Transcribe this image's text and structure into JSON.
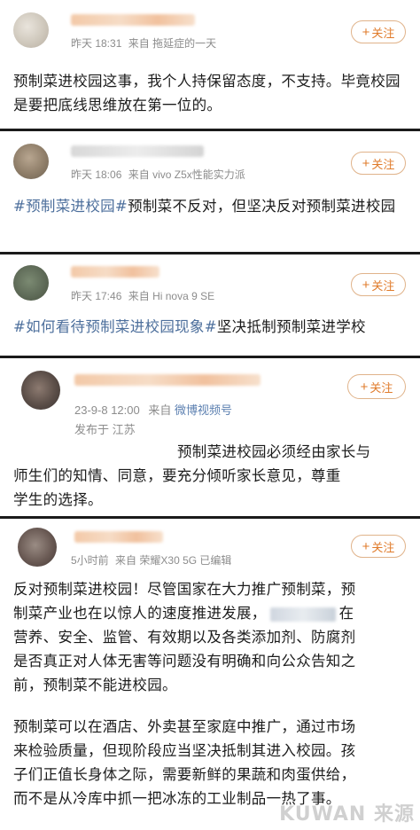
{
  "posts": [
    {
      "time": "昨天 18:31",
      "source_prefix": "来自",
      "source": "拖延症的一天",
      "follow_label": "关注",
      "text": "预制菜进校园这事，我个人持保留态度，不支持。毕竟校园是要把底线思维放在第一位的。"
    },
    {
      "time": "昨天 18:06",
      "source_prefix": "来自",
      "source": "vivo Z5x性能实力派",
      "follow_label": "关注",
      "tag": "#预制菜进校园#",
      "text": "预制菜不反对，但坚决反对预制菜进校园"
    },
    {
      "time": "昨天 17:46",
      "source_prefix": "来自",
      "source": "Hi nova 9 SE",
      "follow_label": "关注",
      "tag1": "#如何看待预制菜进校园现象#",
      "tag2": "坚决抵制预制菜进学校"
    },
    {
      "time": "23-9-8 12:00",
      "source_prefix": "来自",
      "source": "微博视频号",
      "location": "发布于 江苏",
      "follow_label": "关注",
      "line1": "预制菜进校园必须经由家长与",
      "line2": "师生们的知情、同意，要充分倾听家长意见，尊重",
      "line3": "学生的选择。"
    },
    {
      "time": "5小时前",
      "source_prefix": "来自",
      "source": "荣耀X30 5G 已编辑",
      "follow_label": "关注",
      "p1_line1": "反对预制菜进校园！尽管国家在大力推广预制菜，预",
      "p1_line2a": "制菜产业也在以惊人的速度推进发展，",
      "p1_line2b": "在",
      "p1_line3": "营养、安全、监管、有效期以及各类添加剂、防腐剂",
      "p1_line4": "是否真正对人体无害等问题没有明确和向公众告知之",
      "p1_line5": "前，预制菜不能进校园。",
      "p2_line1": "预制菜可以在酒店、外卖甚至家庭中推广，通过市场",
      "p2_line2": "来检验质量，但现阶段应当坚决抵制其进入校园。孩",
      "p2_line3": "子们正值长身体之际，需要新鲜的果蔬和肉蛋供给，",
      "p2_line4": "而不是从冷库中抓一把冰冻的工业制品一热了事。"
    }
  ],
  "watermark": "KUWAN 来源"
}
